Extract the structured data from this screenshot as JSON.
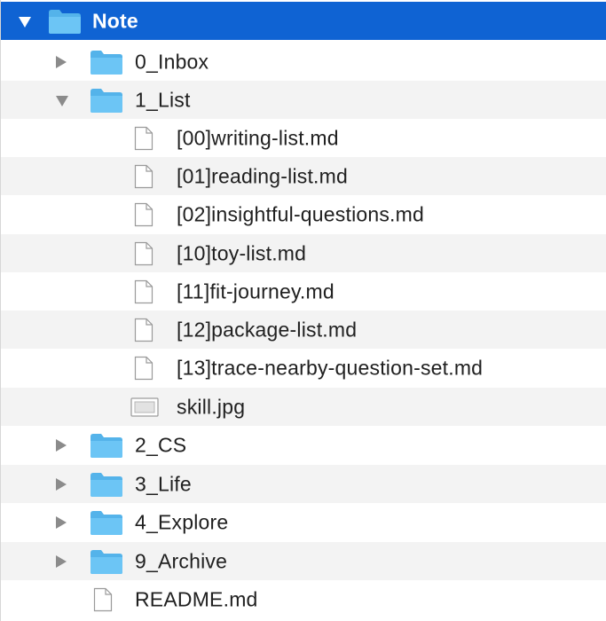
{
  "tree": {
    "root": {
      "label": "Note",
      "expanded": true,
      "selected": true,
      "icon": "folder-icon"
    },
    "items": [
      {
        "label": "0_Inbox",
        "kind": "folder",
        "expanded": false,
        "icon": "folder-icon"
      },
      {
        "label": "1_List",
        "kind": "folder",
        "expanded": true,
        "icon": "folder-icon",
        "children": [
          {
            "label": "[00]writing-list.md",
            "kind": "file",
            "icon": "document-icon"
          },
          {
            "label": "[01]reading-list.md",
            "kind": "file",
            "icon": "document-icon"
          },
          {
            "label": "[02]insightful-questions.md",
            "kind": "file",
            "icon": "document-icon"
          },
          {
            "label": "[10]toy-list.md",
            "kind": "file",
            "icon": "document-icon"
          },
          {
            "label": "[11]fit-journey.md",
            "kind": "file",
            "icon": "document-icon"
          },
          {
            "label": "[12]package-list.md",
            "kind": "file",
            "icon": "document-icon"
          },
          {
            "label": "[13]trace-nearby-question-set.md",
            "kind": "file",
            "icon": "document-icon"
          },
          {
            "label": "skill.jpg",
            "kind": "image",
            "icon": "image-icon"
          }
        ]
      },
      {
        "label": "2_CS",
        "kind": "folder",
        "expanded": false,
        "icon": "folder-icon"
      },
      {
        "label": "3_Life",
        "kind": "folder",
        "expanded": false,
        "icon": "folder-icon"
      },
      {
        "label": "4_Explore",
        "kind": "folder",
        "expanded": false,
        "icon": "folder-icon"
      },
      {
        "label": "9_Archive",
        "kind": "folder",
        "expanded": false,
        "icon": "folder-icon"
      },
      {
        "label": "README.md",
        "kind": "file",
        "icon": "document-icon"
      }
    ]
  },
  "colors": {
    "selection": "#0f63d3",
    "folder": "#5ab8ef",
    "folder_tab": "#6cc5f5",
    "alt_row": "#f3f3f3",
    "disclosure": "#8b8b8b"
  }
}
